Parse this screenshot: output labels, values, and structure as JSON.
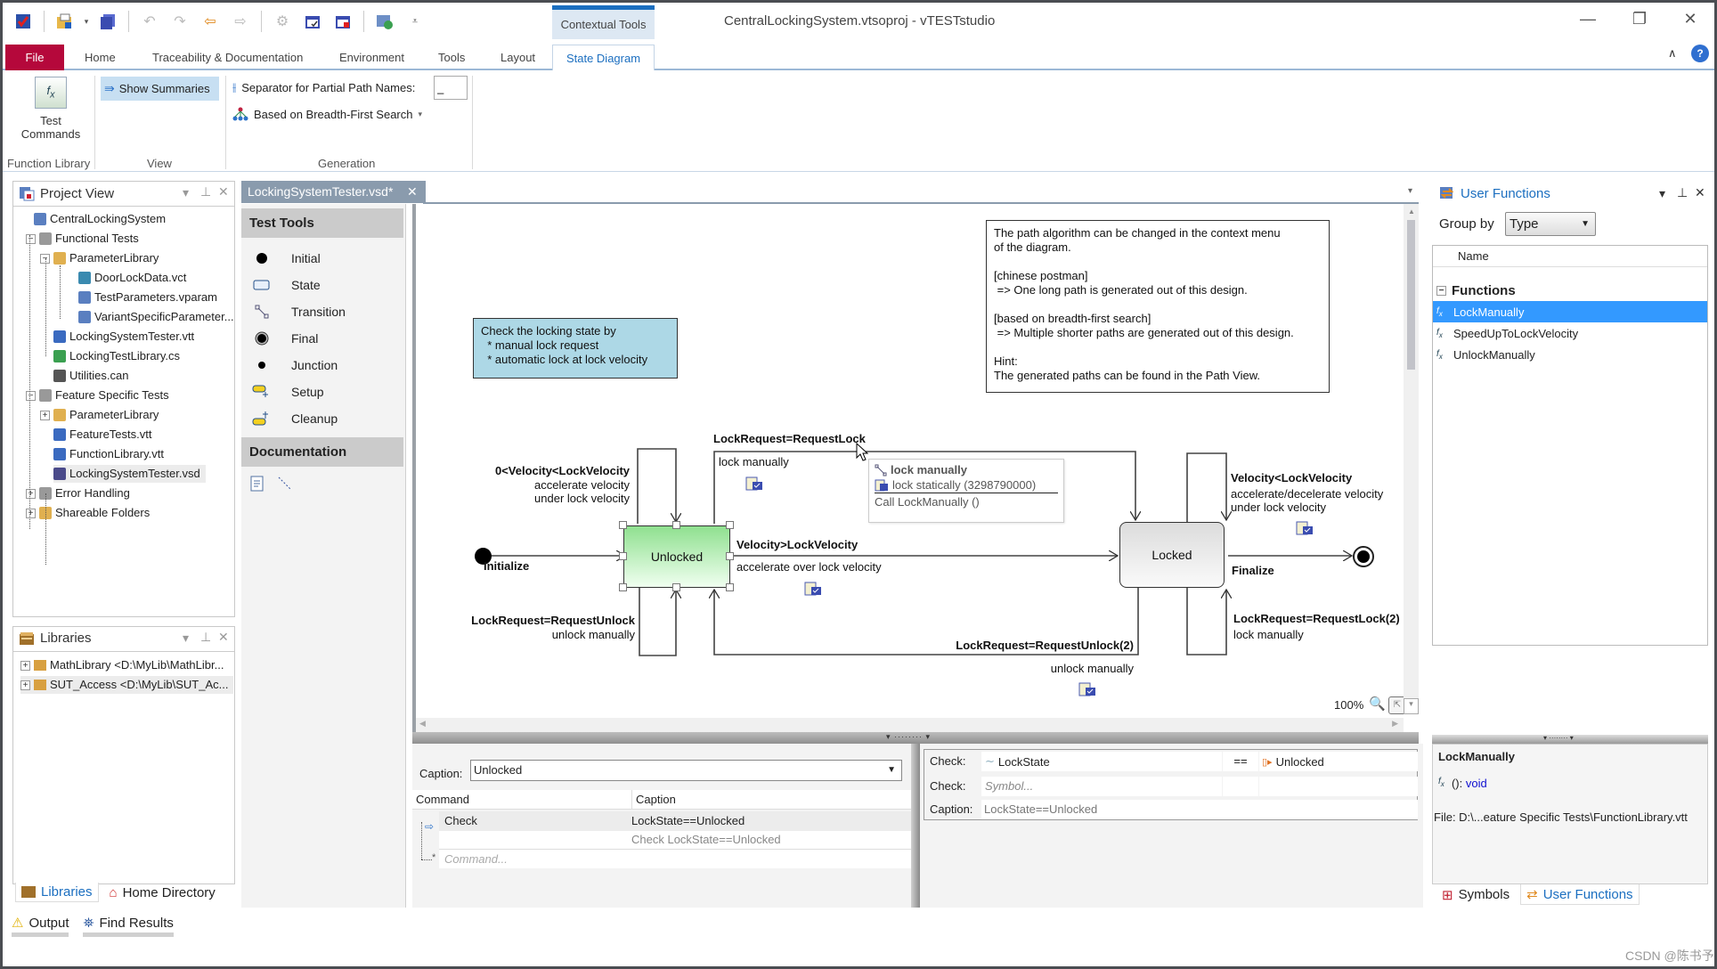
{
  "window": {
    "title": "CentralLockingSystem.vtsoproj - vTESTstudio",
    "contextual_tools": "Contextual Tools",
    "controls": {
      "minimize": "—",
      "restore": "❐",
      "close": "✕"
    }
  },
  "quick_access": {
    "icons": [
      "app-logo-icon",
      "open-project-icon",
      "save-icon",
      "undo-icon",
      "redo-icon",
      "back-icon",
      "forward-icon",
      "build-icon",
      "generate-icon",
      "generate-all-icon",
      "environment-icon",
      "customize-icon"
    ]
  },
  "ribbon": {
    "tabs": [
      {
        "label": "File"
      },
      {
        "label": "Home"
      },
      {
        "label": "Traceability & Documentation"
      },
      {
        "label": "Environment"
      },
      {
        "label": "Tools"
      },
      {
        "label": "Layout"
      },
      {
        "label": "State Diagram"
      }
    ],
    "active_tab": "State Diagram",
    "groups": {
      "function_library": {
        "label": "Function Library",
        "test_commands": "Test\nCommands",
        "test_commands_l1": "Test",
        "test_commands_l2": "Commands"
      },
      "view": {
        "label": "View",
        "show_summaries": "Show Summaries"
      },
      "generation": {
        "label": "Generation",
        "separator_label": "Separator for Partial Path Names:",
        "separator_value": "_",
        "algorithm": "Based on Breadth-First Search"
      }
    },
    "collapse": "∧",
    "help": "?"
  },
  "project_view": {
    "title": "Project View",
    "items": [
      {
        "label": "CentralLockingSystem",
        "level": 0,
        "icon": "project-icon"
      },
      {
        "label": "Functional Tests",
        "level": 1,
        "icon": "test-unit-icon",
        "expander": "−"
      },
      {
        "label": "ParameterLibrary",
        "level": 2,
        "icon": "folder-icon",
        "expander": "−"
      },
      {
        "label": "DoorLockData.vct",
        "level": 3,
        "icon": "vct-file-icon"
      },
      {
        "label": "TestParameters.vparam",
        "level": 3,
        "icon": "vparam-file-icon"
      },
      {
        "label": "VariantSpecificParameter...",
        "level": 3,
        "icon": "vparam-file-icon"
      },
      {
        "label": "LockingSystemTester.vtt",
        "level": 2,
        "icon": "vtt-file-icon"
      },
      {
        "label": "LockingTestLibrary.cs",
        "level": 2,
        "icon": "cs-file-icon"
      },
      {
        "label": "Utilities.can",
        "level": 2,
        "icon": "can-file-icon"
      },
      {
        "label": "Feature Specific Tests",
        "level": 1,
        "icon": "test-unit-icon",
        "expander": "−"
      },
      {
        "label": "ParameterLibrary",
        "level": 2,
        "icon": "folder-icon",
        "expander": "+"
      },
      {
        "label": "FeatureTests.vtt",
        "level": 2,
        "icon": "vtt-file-icon"
      },
      {
        "label": "FunctionLibrary.vtt",
        "level": 2,
        "icon": "vtt-file-icon"
      },
      {
        "label": "LockingSystemTester.vsd",
        "level": 2,
        "icon": "vsd-file-icon",
        "selected": true
      },
      {
        "label": "Error Handling",
        "level": 1,
        "icon": "test-unit-icon",
        "expander": "+"
      },
      {
        "label": "Shareable Folders",
        "level": 1,
        "icon": "shared-folder-icon",
        "expander": "+"
      }
    ]
  },
  "libraries": {
    "title": "Libraries",
    "items": [
      {
        "label": "MathLibrary <D:\\MyLib\\MathLibr..."
      },
      {
        "label": "SUT_Access <D:\\MyLib\\SUT_Ac..."
      }
    ],
    "tabs": [
      {
        "label": "Libraries",
        "active": true
      },
      {
        "label": "Home Directory"
      }
    ]
  },
  "bottom_dock": {
    "tabs": [
      {
        "label": "Output"
      },
      {
        "label": "Find Results"
      }
    ]
  },
  "document": {
    "tab_label": "LockingSystemTester.vsd*",
    "toolbox": {
      "test_tools_header": "Test Tools",
      "tools": [
        {
          "label": "Initial",
          "icon": "initial-node-icon"
        },
        {
          "label": "State",
          "icon": "state-icon"
        },
        {
          "label": "Transition",
          "icon": "transition-icon"
        },
        {
          "label": "Final",
          "icon": "final-node-icon"
        },
        {
          "label": "Junction",
          "icon": "junction-icon"
        },
        {
          "label": "Setup",
          "icon": "setup-icon"
        },
        {
          "label": "Cleanup",
          "icon": "cleanup-icon"
        }
      ],
      "documentation_header": "Documentation"
    },
    "diagram": {
      "note_left": "Check the locking state by\n  * manual lock request\n  * automatic lock at lock velocity",
      "note_right": "The path algorithm can be changed in the context menu\nof the diagram.\n\n[chinese postman]\n => One long path is generated out of this design.\n\n[based on breadth-first search]\n => Multiple shorter paths are generated out of this design.\n\nHint:\nThe generated paths can be found in the Path View.",
      "states": {
        "unlocked": "Unlocked",
        "locked": "Locked"
      },
      "transitions": {
        "initialize": "Initialize",
        "self_unlocked_guard": "0<Velocity<LockVelocity",
        "self_unlocked_action_1": "accelerate velocity",
        "self_unlocked_action_2": "under lock velocity",
        "lock_request_guard": "LockRequest=RequestLock",
        "lock_request_action": "lock manually",
        "velocity_over_guard": "Velocity>LockVelocity",
        "velocity_over_action": "accelerate over lock velocity",
        "unlock_request_guard": "LockRequest=RequestUnlock",
        "unlock_request_action": "unlock manually",
        "unlock_request2_guard": "LockRequest=RequestUnlock(2)",
        "unlock_request2_action": "unlock manually",
        "locked_self_guard": "Velocity<LockVelocity",
        "locked_self_action_1": "accelerate/decelerate velocity",
        "locked_self_action_2": "under lock velocity",
        "finalize": "Finalize",
        "lock_request2_guard": "LockRequest=RequestLock(2)",
        "lock_request2_action": "lock manually"
      },
      "tooltip": {
        "title": "lock manually",
        "line2": "lock statically (3298790000)",
        "line3": "Call LockManually ()"
      },
      "zoom_level": "100%"
    },
    "command_editor": {
      "caption_label": "Caption:",
      "caption_value": "Unlocked",
      "columns": [
        "Command",
        "Caption"
      ],
      "rows": [
        {
          "command": "Check",
          "caption": "LockState==Unlocked",
          "sub": "Check LockState==Unlocked"
        }
      ],
      "new_command_placeholder": "Command..."
    },
    "check_editor": {
      "rows": [
        {
          "label": "Check:",
          "symbol": "LockState",
          "op": "==",
          "value": "Unlocked"
        },
        {
          "label": "Check:",
          "symbol_placeholder": "Symbol..."
        }
      ],
      "caption_label": "Caption:",
      "caption_value": "LockState==Unlocked"
    }
  },
  "user_functions": {
    "title": "User Functions",
    "group_by_label": "Group by",
    "group_by_value": "Type",
    "column": "Name",
    "group": "Functions",
    "items": [
      {
        "label": "LockManually",
        "selected": true
      },
      {
        "label": "SpeedUpToLockVelocity"
      },
      {
        "label": "UnlockManually"
      }
    ],
    "detail": {
      "name": "LockManually",
      "signature_prefix": "(): ",
      "signature_type": "void",
      "file": "File: D:\\...eature Specific Tests\\FunctionLibrary.vtt"
    },
    "tabs": [
      {
        "label": "Symbols"
      },
      {
        "label": "User Functions",
        "active": true
      }
    ]
  },
  "watermark": "CSDN @陈书予",
  "colors": {
    "accent": "#1c6fc0",
    "file_tab": "#b5083b",
    "selection": "#3399ff",
    "note_blue": "#add8e6",
    "unlocked_green": "#90e090"
  }
}
